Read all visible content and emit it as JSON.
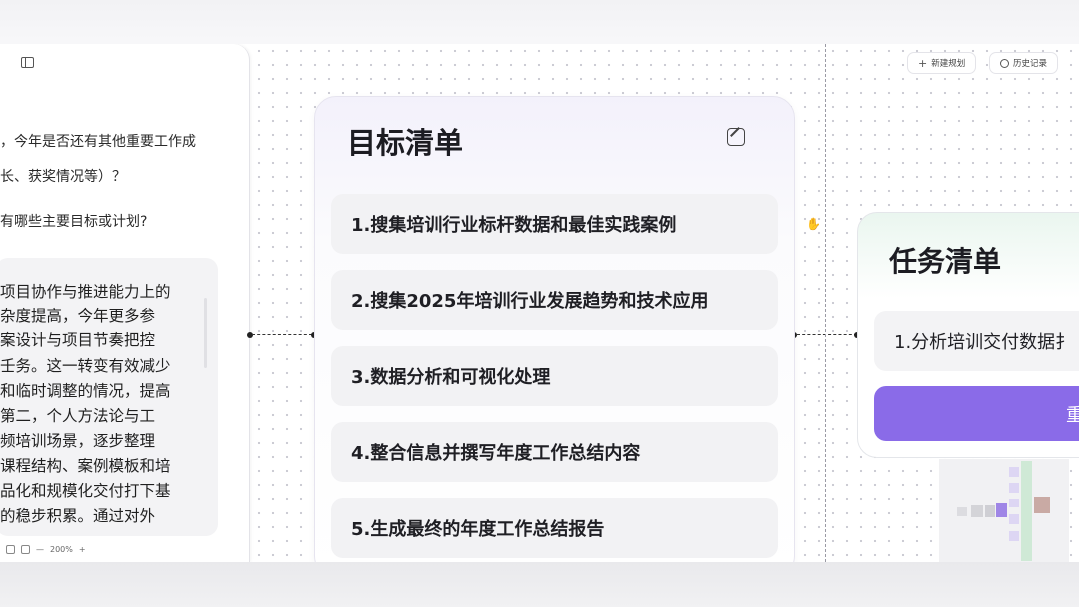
{
  "chat": {
    "question_lines": [
      "，今年是否还有其他重要工作成",
      "长、获奖情况等）？",
      "有哪些主要目标或计划?"
    ],
    "answer_lines": [
      "项目协作与推进能力上的",
      "杂度提高，今年更多参",
      "案设计与项目节奏把控",
      "壬务。这一转变有效减少",
      "和临时调整的情况，提高",
      "第二，个人方法论与工",
      "频培训场景，逐步整理",
      "课程结构、案例模板和培",
      "品化和规模化交付打下基",
      "的稳步积累。通过对外"
    ],
    "zoom_level": "200%"
  },
  "toolbar": {
    "new_plan": "新建规划",
    "history": "历史记录"
  },
  "goal_list": {
    "title": "目标清单",
    "items": [
      "1.搜集培训行业标杆数据和最佳实践案例",
      "2.搜集2025年培训行业发展趋势和技术应用",
      "3.数据分析和可视化处理",
      "4.整合信息并撰写年度工作总结内容",
      "5.生成最终的年度工作总结报告"
    ]
  },
  "task_list": {
    "title": "任务清单",
    "items": [
      "1.分析培训交付数据扌"
    ],
    "button_label": "重"
  },
  "colors": {
    "accent": "#8a6be8"
  }
}
